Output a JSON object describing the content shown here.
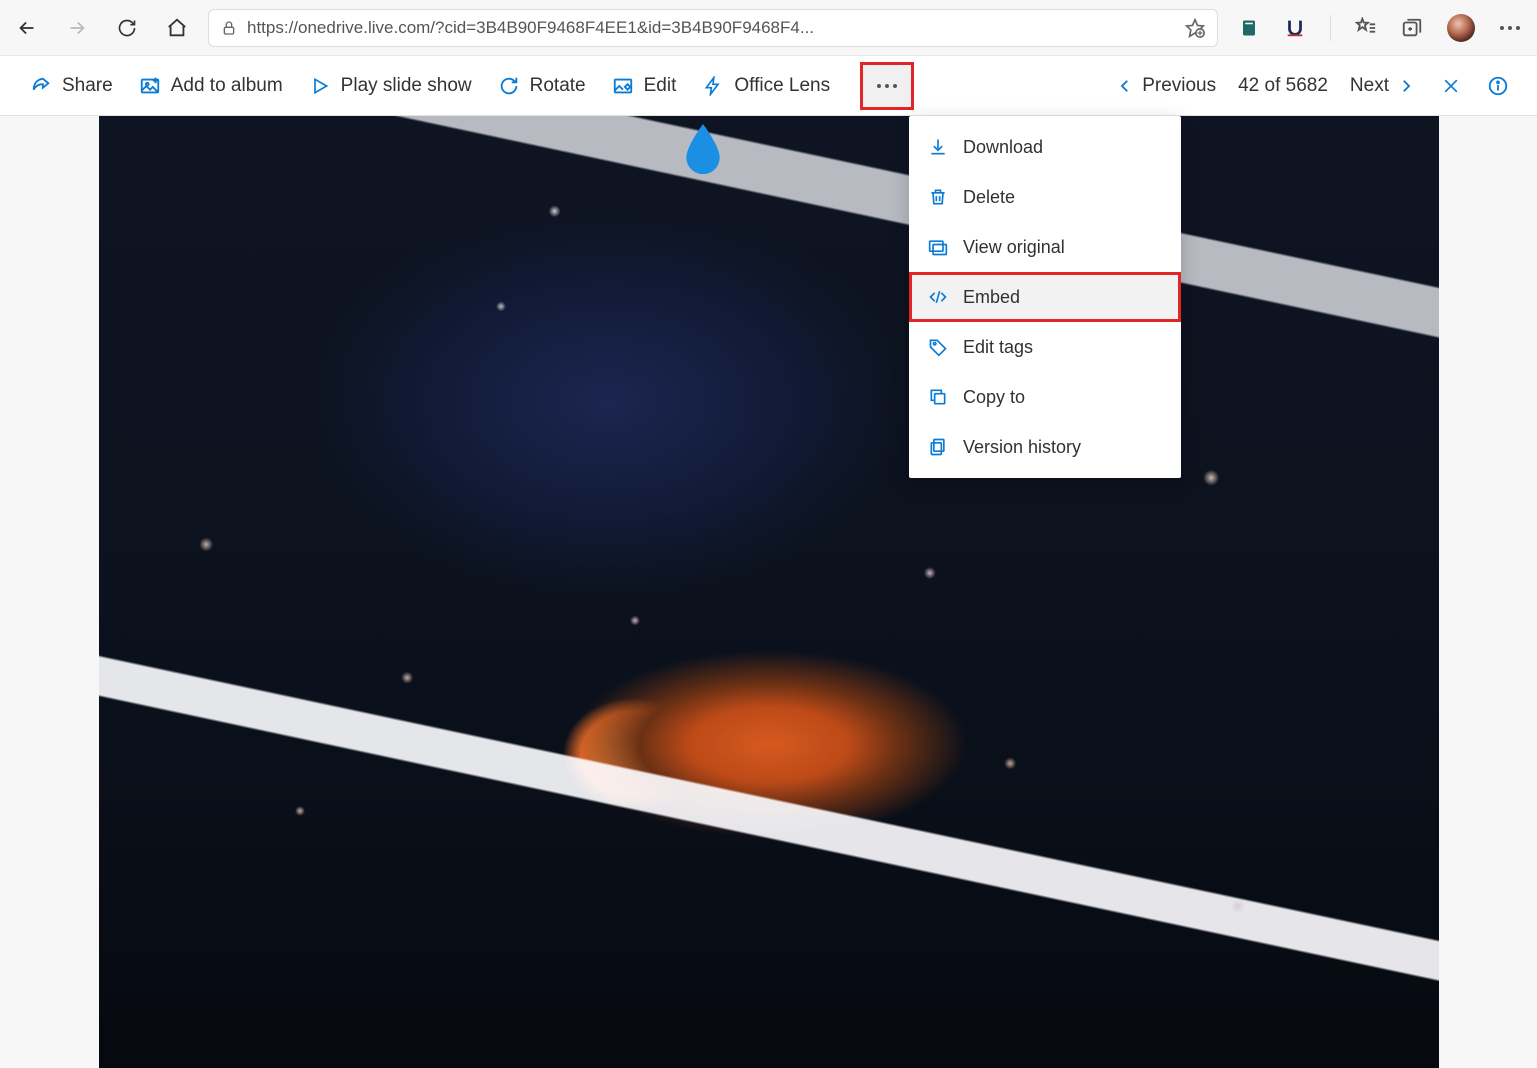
{
  "browser": {
    "url": "https://onedrive.live.com/?cid=3B4B90F9468F4EE1&id=3B4B90F9468F4..."
  },
  "toolbar": {
    "share": "Share",
    "add_album": "Add to album",
    "slide_show": "Play slide show",
    "rotate": "Rotate",
    "edit": "Edit",
    "office_lens": "Office Lens"
  },
  "pager": {
    "previous": "Previous",
    "index": "42 of 5682",
    "next": "Next"
  },
  "menu": {
    "download": "Download",
    "delete": "Delete",
    "view_original": "View original",
    "embed": "Embed",
    "edit_tags": "Edit tags",
    "copy_to": "Copy to",
    "version_history": "Version history"
  },
  "highlight": {
    "more_button": true,
    "embed_item": true
  },
  "colors": {
    "accent": "#0a7bd6",
    "highlight_border": "#e02626"
  }
}
